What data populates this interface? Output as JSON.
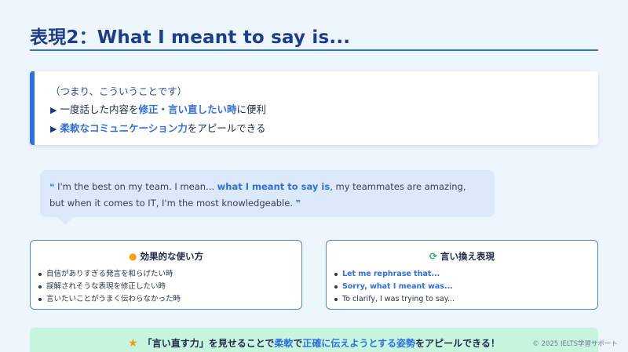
{
  "title": "表現2：What I meant to say is...",
  "info": {
    "subtitle": "（つまり、こういうことです）",
    "line1_pre": "一度話した内容を",
    "line1_hl": "修正・言い直したい時",
    "line1_post": "に便利",
    "line2_hl": "柔軟なコミュニケーション力",
    "line2_post": "をアピールできる"
  },
  "quote": {
    "open_mark": "❝",
    "pre": "I'm the best on my team. I mean... ",
    "hl": "what I meant to say is",
    "post": ", my teammates are amazing, but when it comes to IT, I'm the most knowledgeable.",
    "close_mark": "❞"
  },
  "card_left": {
    "icon": "lightbulb-icon",
    "title": "効果的な使い方",
    "items": [
      "自信がありすぎる発言を和らげたい時",
      "誤解されそうな表現を修正したい時",
      "言いたいことがうまく伝わらなかった時"
    ]
  },
  "card_right": {
    "icon": "refresh-icon",
    "title": "言い換え表現",
    "items": [
      "Let me rephrase that...",
      "Sorry, what I meant was...",
      "To clarify, I was trying to say..."
    ]
  },
  "banner": {
    "icon": "star-icon",
    "t1": "「言い直す力」を見せることで",
    "h1": "柔軟",
    "t2": "で",
    "h2": "正確に伝えようとする姿勢",
    "t3": "をアピールできる！"
  },
  "footer": "© 2025 IELTS学習サポート",
  "colors": {
    "accent": "#2f6fe0",
    "title": "#1c3d8c",
    "banner_bg": "#c8f5de",
    "quote_bg": "#dbe9fb"
  }
}
